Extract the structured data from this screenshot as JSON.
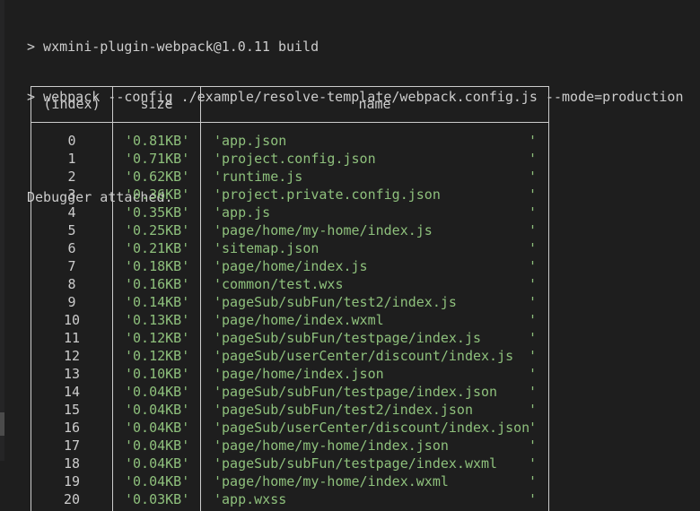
{
  "terminal": {
    "lines": [
      "> wxmini-plugin-webpack@1.0.11 build",
      "> webpack --config ./example/resolve-template/webpack.config.js --mode=production"
    ],
    "debugger": "Debugger attached."
  },
  "table": {
    "headers": [
      "(index)",
      "size",
      "name"
    ],
    "rows": [
      {
        "index": "0",
        "size": "'0.81KB'",
        "name": "'app.json"
      },
      {
        "index": "1",
        "size": "'0.71KB'",
        "name": "'project.config.json"
      },
      {
        "index": "2",
        "size": "'0.62KB'",
        "name": "'runtime.js"
      },
      {
        "index": "3",
        "size": "'0.36KB'",
        "name": "'project.private.config.json"
      },
      {
        "index": "4",
        "size": "'0.35KB'",
        "name": "'app.js"
      },
      {
        "index": "5",
        "size": "'0.25KB'",
        "name": "'page/home/my-home/index.js"
      },
      {
        "index": "6",
        "size": "'0.21KB'",
        "name": "'sitemap.json"
      },
      {
        "index": "7",
        "size": "'0.18KB'",
        "name": "'page/home/index.js"
      },
      {
        "index": "8",
        "size": "'0.16KB'",
        "name": "'common/test.wxs"
      },
      {
        "index": "9",
        "size": "'0.14KB'",
        "name": "'pageSub/subFun/test2/index.js"
      },
      {
        "index": "10",
        "size": "'0.13KB'",
        "name": "'page/home/index.wxml"
      },
      {
        "index": "11",
        "size": "'0.12KB'",
        "name": "'pageSub/subFun/testpage/index.js"
      },
      {
        "index": "12",
        "size": "'0.12KB'",
        "name": "'pageSub/userCenter/discount/index.js"
      },
      {
        "index": "13",
        "size": "'0.10KB'",
        "name": "'page/home/index.json"
      },
      {
        "index": "14",
        "size": "'0.04KB'",
        "name": "'pageSub/subFun/testpage/index.json"
      },
      {
        "index": "15",
        "size": "'0.04KB'",
        "name": "'pageSub/subFun/test2/index.json"
      },
      {
        "index": "16",
        "size": "'0.04KB'",
        "name": "'pageSub/userCenter/discount/index.json"
      },
      {
        "index": "17",
        "size": "'0.04KB'",
        "name": "'page/home/my-home/index.json"
      },
      {
        "index": "18",
        "size": "'0.04KB'",
        "name": "'pageSub/subFun/testpage/index.wxml"
      },
      {
        "index": "19",
        "size": "'0.04KB'",
        "name": "'page/home/my-home/index.wxml"
      },
      {
        "index": "20",
        "size": "'0.03KB'",
        "name": "'app.wxss"
      }
    ],
    "closing_quote": "'"
  },
  "colors": {
    "background": "#1e1e1e",
    "text": "#cccccc",
    "string": "#8ec07c"
  }
}
